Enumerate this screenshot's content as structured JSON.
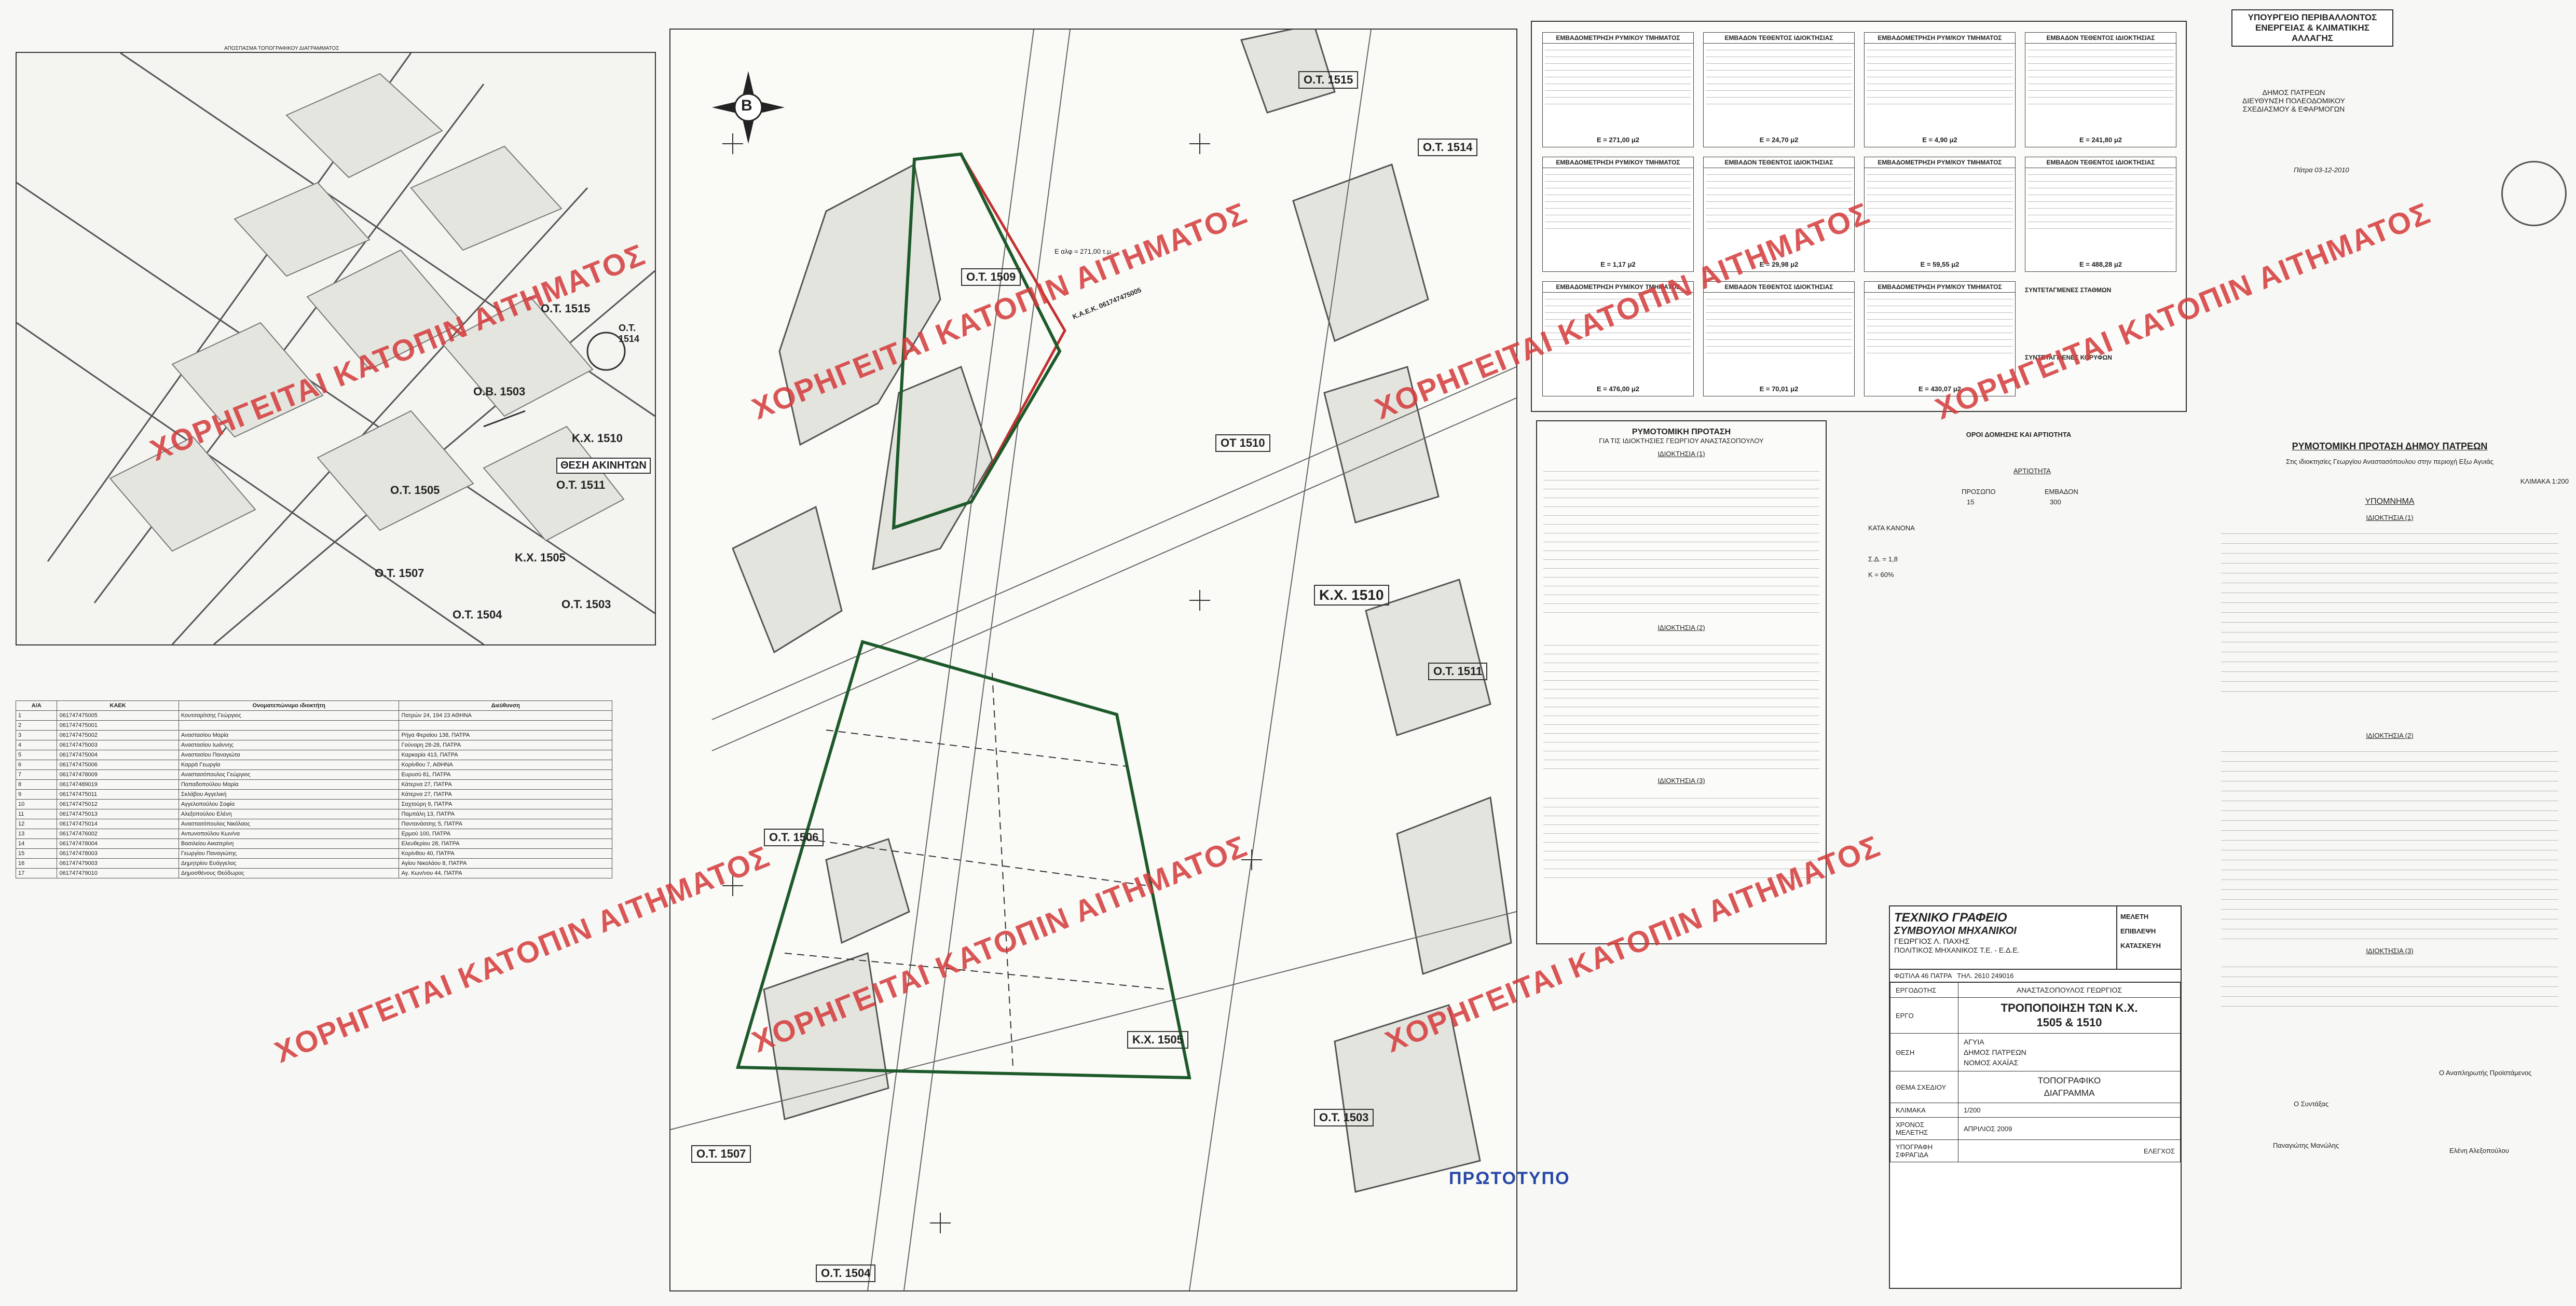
{
  "header_stamp": {
    "line1": "ΥΠΟΥΡΓΕΙΟ ΠΕΡΙΒΑΛΛΟΝΤΟΣ",
    "line2": "ΕΝΕΡΓΕΙΑΣ & ΚΛΙΜΑΤΙΚΗΣ ΑΛΛΑΓΗΣ"
  },
  "authority": {
    "line1": "ΔΗΜΟΣ ΠΑΤΡΕΩΝ",
    "line2": "ΔΙΕΥΘΥΝΣΗ ΠΟΛΕΟΔΟΜΙΚΟΥ",
    "line3": "ΣΧΕΔΙΑΣΜΟΥ & ΕΦΑΡΜΟΓΩΝ",
    "date": "Πάτρα 03-12-2010"
  },
  "watermark": "ΧΟΡΗΓΕΙΤΑΙ ΚΑΤΟΠΙΝ ΑΙΤΗΜΑΤΟΣ",
  "left_map": {
    "title": "ΑΠΟΣΠΑΣΜΑ ΤΟΠΟΓΡΑΦΙΚΟΥ ΔΙΑΓΡΑΜΜΑΤΟΣ",
    "blocks": [
      "Ο.Τ. 1515",
      "Ο.Τ. 1514",
      "Ο.Β. 1503",
      "Κ.Χ. 1510",
      "Ο.Τ. 1505",
      "Ο.Τ. 1511",
      "Κ.Χ. 1505",
      "Ο.Τ. 1507",
      "Ο.Τ. 1504",
      "Ο.Τ. 1503"
    ],
    "position_label": "ΘΕΣΗ ΑΚΙΝΗΤΩΝ"
  },
  "owners_table": {
    "headers": [
      "Α/Α",
      "ΚΑΕΚ",
      "Ονοματεπώνυμο ιδιοκτήτη",
      "Διεύθυνση"
    ],
    "rows": [
      [
        "1",
        "061747475005",
        "Κουτσαρίτσης Γεώργιος",
        "Πατρών 24, 194 23 ΑΘΗΝΑ"
      ],
      [
        "2",
        "061747475001",
        "",
        ""
      ],
      [
        "3",
        "061747475002",
        "Αναστασίου Μαρία",
        "Ρήγα Φεραίου 138, ΠΑΤΡΑ"
      ],
      [
        "4",
        "061747475003",
        "Αναστασίου Ιωάννης",
        "Γούναρη 28-28, ΠΑΤΡΑ"
      ],
      [
        "5",
        "061747475004",
        "Αναστασίου Παναγιώτα",
        "Καρκαρία 413, ΠΑΤΡΑ"
      ],
      [
        "6",
        "061747475006",
        "Καρρά Γεωργία",
        "Κορίνθου 7, ΑΘΗΝΑ"
      ],
      [
        "7",
        "061747478009",
        "Αναστασόπουλος Γεώργιος",
        "Ευρυσύ 81, ΠΑΤΡΑ"
      ],
      [
        "8",
        "061747489019",
        "Παπαδοπούλου Μαρία",
        "Κάτερνα 27, ΠΑΤΡΑ"
      ],
      [
        "9",
        "061747475011",
        "Σκλάβου Αγγελική",
        "Κάτερνα 27, ΠΑΤΡΑ"
      ],
      [
        "10",
        "061747475012",
        "Αγγελοπούλου Σοφία",
        "Σαχτούρη 9, ΠΑΤΡΑ"
      ],
      [
        "11",
        "061747475013",
        "Αλεξοπούλου Ελένη",
        "Παμπάλη 13, ΠΑΤΡΑ"
      ],
      [
        "12",
        "061747475014",
        "Αναστασόπουλος Νικόλαος",
        "Παντανάσσης 5, ΠΑΤΡΑ"
      ],
      [
        "13",
        "061747476002",
        "Αντωνοπούλου Κων/να",
        "Ερμού 100, ΠΑΤΡΑ"
      ],
      [
        "14",
        "061747478004",
        "Βασιλείου Αικατερίνη",
        "Ελευθερίου 28, ΠΑΤΡΑ"
      ],
      [
        "15",
        "061747478003",
        "Γεωργίου Παναγιώτης",
        "Κορίνθου 40, ΠΑΤΡΑ"
      ],
      [
        "16",
        "061747479003",
        "Δημητρίου Ευάγγελος",
        "Αγίου Νικολάου 8, ΠΑΤΡΑ"
      ],
      [
        "17",
        "061747479010",
        "Δημοσθένους Θεόδωρος",
        "Αγ. Κων/νου 44, ΠΑΤΡΑ"
      ]
    ]
  },
  "main_plan": {
    "blocks": [
      "Ο.Τ. 1515",
      "Ο.Τ. 1514",
      "Ο.Τ. 1509",
      "ΟΤ 1510",
      "Κ.Χ. 1510",
      "Ο.Τ. 1506",
      "Ο.Τ. 1511",
      "Κ.Χ. 1505",
      "Ο.Τ. 1507",
      "Ο.Τ. 1503",
      "Ο.Τ. 1504"
    ],
    "parcel_code": "Κ.Α.Ε.Κ. 061747475005",
    "area_note": "Ε αλφ = 271,00 τ.μ.",
    "stamp": "ΠΡΩΤΟΤΥΠΟ"
  },
  "area_tables": {
    "title1": "ΕΜΒΑΔΟΜΕΤΡΗΣΗ ΡΥΜ/ΚΟΥ ΤΜΗΜΑΤΟΣ",
    "title2": "ΕΜΒΑΔΟΝ ΤΕΘΕΝΤΟΣ ΙΔΙΟΚΤΗΣΙΑΣ",
    "values": [
      "E = 271,00 μ2",
      "E = 24,70 μ2",
      "E = 4,90 μ2",
      "E = 241,80 μ2",
      "E = 1,17 μ2",
      "E = 29,98 μ2",
      "E = 59,55 μ2",
      "E = 488,28 μ2",
      "E = 476,00 μ2",
      "E = 70,01 μ2",
      "E = 430,07 μ2"
    ],
    "coords_title": "ΣΥΝΤΕΤΑΓΜΕΝΕΣ ΣΤΑΘΜΩΝ",
    "coords_title2": "ΣΥΝΤΕΤΑΓΜΕΝΕΣ ΚΟΡΥΦΩΝ"
  },
  "proposal": {
    "title": "ΡΥΜΟΤΟΜΙΚΗ ΠΡΟΤΑΣΗ",
    "subtitle": "ΓΙΑ ΤΙΣ ΙΔΙΟΚΤΗΣΙΕΣ ΓΕΩΡΓΙΟΥ ΑΝΑΣΤΑΣΟΠΟΥΛΟΥ",
    "section1": "ΙΔΙΟΚΤΗΣΙΑ (1)",
    "section2": "ΙΔΙΟΚΤΗΣΙΑ (2)",
    "section3": "ΙΔΙΟΚΤΗΣΙΑ (3)"
  },
  "building_terms": {
    "title": "ΟΡΟΙ ΔΟΜΗΣΗΣ ΚΑΙ ΑΡΤΙΟΤΗΤΑ",
    "artiotita": "ΑΡΤΙΟΤΗΤΑ",
    "prosopo_label": "ΠΡΟΣΩΠΟ",
    "prosopo_value": "15",
    "emvadon_label": "ΕΜΒΑΔΟΝ",
    "emvadon_value": "300",
    "kata_kanona": "ΚΑΤΑ ΚΑΝΟΝΑ",
    "syntelestis": "Σ.Δ. = 1,8",
    "kalypsi": "Κ = 60%"
  },
  "right_panel": {
    "title": "ΡΥΜΟΤΟΜΙΚΗ ΠΡΟΤΑΣΗ ΔΗΜΟΥ ΠΑΤΡΕΩΝ",
    "subtitle": "Στις ιδιοκτησίες Γεωργίου Αναστασόπουλου στην περιοχή Εξω Αγυιάς",
    "scale": "ΚΛΙΜΑΚΑ 1:200",
    "legend": "ΥΠΟΜΝΗΜΑ",
    "idiokt1": "ΙΔΙΟΚΤΗΣΙΑ (1)",
    "idiokt2": "ΙΔΙΟΚΤΗΣΙΑ (2)",
    "idiokt3": "ΙΔΙΟΚΤΗΣΙΑ (3)",
    "signer1": "Ο Συντάξας",
    "signer2": "Ο Αναπληρωτής Προϊστάμενος",
    "name1": "Παναγιώτης Μανώλης",
    "name2": "Ελένη Αλεξοπούλου"
  },
  "title_block": {
    "office": "ΤΕΧΝΙΚΟ ΓΡΑΦΕΙΟ",
    "office2": "ΣΥΜΒΟΥΛΟΙ ΜΗΧΑΝΙΚΟΙ",
    "engineer": "ΓΕΩΡΓΙΟΣ Λ. ΠΑΧΗΣ",
    "engineer_title": "ΠΟΛΙΤΙΚΟΣ ΜΗΧΑΝΙΚΟΣ Τ.Ε. - Ε.Δ.Ε.",
    "address": "ΦΩΤΙΛΑ 46 ΠΑΤΡΑ",
    "phone": "ΤΗΛ. 2610 249016",
    "meleti": "ΜΕΛΕΤΗ",
    "epivlepsi": "ΕΠΙΒΛΕΨΗ",
    "kataskevi": "ΚΑΤΑΣΚΕΥΗ",
    "client_label": "ΕΡΓΟΔΟΤΗΣ",
    "client": "ΑΝΑΣΤΑΣΟΠΟΥΛΟΣ ΓΕΩΡΓΙΟΣ",
    "project_label": "ΕΡΓΟ",
    "project": "ΤΡΟΠΟΠΟΙΗΣΗ ΤΩΝ Κ.Χ.",
    "project2": "1505 & 1510",
    "location_label": "ΘΕΣΗ",
    "location": "ΑΓΥΙΑ",
    "location2": "ΔΗΜΟΣ ΠΑΤΡΕΩΝ",
    "location3": "ΝΟΜΟΣ ΑΧΑΪΑΣ",
    "drawing_label": "ΘΕΜΑ ΣΧΕΔΙΟΥ",
    "drawing": "ΤΟΠΟΓΡΑΦΙΚΟ",
    "drawing2": "ΔΙΑΓΡΑΜΜΑ",
    "scale_label": "ΚΛΙΜΑΚΑ",
    "scale": "1/200",
    "date_label": "ΧΡΟΝΟΣ ΜΕΛΕΤΗΣ",
    "date": "ΑΠΡΙΛΙΟΣ 2009",
    "sign_label": "ΥΠΟΓΡΑΦΗ ΣΦΡΑΓΙΔΑ",
    "check_label": "ΕΛΕΓΧΟΣ"
  },
  "ministry_stamp": {
    "line1": "ΥΠΟΥΡΓΕΙΟ ΠΕΡΙΒΑΛΛΟΝΤΟΣ",
    "line2": "ΕΝΕΡΓΕΙΑΣ & ΚΛΙΜΑΤΙΚΗΣ ΑΛΛΑΓΗΣ"
  },
  "compass": "Β"
}
